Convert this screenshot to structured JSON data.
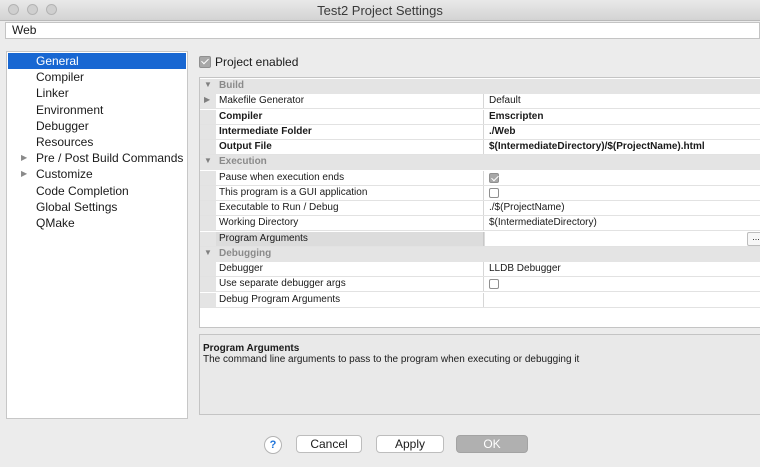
{
  "window": {
    "title": "Test2 Project Settings"
  },
  "config": {
    "selected": "Web"
  },
  "sidebar": {
    "items": [
      {
        "label": "General",
        "selected": true,
        "expandable": false
      },
      {
        "label": "Compiler",
        "selected": false,
        "expandable": false
      },
      {
        "label": "Linker",
        "selected": false,
        "expandable": false
      },
      {
        "label": "Environment",
        "selected": false,
        "expandable": false
      },
      {
        "label": "Debugger",
        "selected": false,
        "expandable": false
      },
      {
        "label": "Resources",
        "selected": false,
        "expandable": false
      },
      {
        "label": "Pre / Post Build Commands",
        "selected": false,
        "expandable": true
      },
      {
        "label": "Customize",
        "selected": false,
        "expandable": true
      },
      {
        "label": "Code Completion",
        "selected": false,
        "expandable": false
      },
      {
        "label": "Global Settings",
        "selected": false,
        "expandable": false
      },
      {
        "label": "QMake",
        "selected": false,
        "expandable": false
      }
    ]
  },
  "general": {
    "project_enabled_label": "Project enabled",
    "project_enabled": true
  },
  "grid": {
    "rows": [
      {
        "type": "category",
        "name": "Build"
      },
      {
        "type": "prop",
        "name": "Makefile Generator",
        "value": "Default",
        "expandable": true
      },
      {
        "type": "prop",
        "name": "Compiler",
        "value": "Emscripten",
        "bold": true
      },
      {
        "type": "prop",
        "name": "Intermediate Folder",
        "value": "./Web",
        "bold": true
      },
      {
        "type": "prop",
        "name": "Output File",
        "value": "$(IntermediateDirectory)/$(ProjectName).html",
        "bold": true
      },
      {
        "type": "category",
        "name": "Execution"
      },
      {
        "type": "check",
        "name": "Pause when execution ends",
        "checked": true
      },
      {
        "type": "check",
        "name": "This program is a GUI application",
        "checked": false
      },
      {
        "type": "prop",
        "name": "Executable to Run / Debug",
        "value": "./$(ProjectName)"
      },
      {
        "type": "prop",
        "name": "Working Directory",
        "value": "$(IntermediateDirectory)"
      },
      {
        "type": "prop",
        "name": "Program Arguments",
        "value": "",
        "highlighted": true,
        "ellipsis": "..."
      },
      {
        "type": "category",
        "name": "Debugging"
      },
      {
        "type": "prop",
        "name": "Debugger",
        "value": "LLDB Debugger"
      },
      {
        "type": "check",
        "name": "Use separate debugger args",
        "checked": false
      },
      {
        "type": "prop",
        "name": "Debug Program Arguments",
        "value": ""
      }
    ]
  },
  "help": {
    "title": "Program Arguments",
    "description": "The command line arguments to pass to the program when executing or debugging it"
  },
  "buttons": {
    "help": "?",
    "cancel": "Cancel",
    "apply": "Apply",
    "ok": "OK"
  }
}
